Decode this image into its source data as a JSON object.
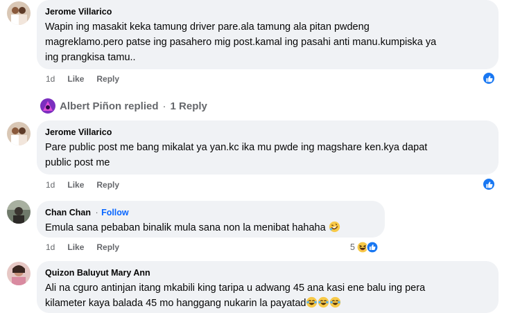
{
  "comments": [
    {
      "author": "Jerome Villarico",
      "text_lines": [
        "Wapin ing masakit keka tamung driver pare.ala tamung ala pitan pwdeng",
        "magreklamo.pero patse ing pasahero mig post.kamal ing pasahi anti manu.kumpiska ya",
        "ing prangkisa tamu.."
      ],
      "age": "1d",
      "like_label": "Like",
      "reply_label": "Reply",
      "reaction": "like"
    },
    {
      "author": "Jerome Villarico",
      "text_lines": [
        "Pare public post me bang mikalat ya yan.kc ika mu pwde ing magshare ken.kya dapat",
        "public post me"
      ],
      "age": "1d",
      "like_label": "Like",
      "reply_label": "Reply",
      "reaction": "like"
    },
    {
      "author": "Chan Chan",
      "separator": "·",
      "follow_label": "Follow",
      "text": "Emula sana pebaban binalik mula sana non la menibat hahaha",
      "emoji": "rofl",
      "age": "1d",
      "like_label": "Like",
      "reply_label": "Reply",
      "reaction_count": "5",
      "reactions": [
        "haha",
        "like"
      ]
    },
    {
      "author": "Quizon Baluyut Mary Ann",
      "text_lines": [
        "Ali na cguro antinjan itang mkabili king taripa u adwang 45 ana kasi ene balu ing pera",
        "kilameter kaya balada 45 mo hanggang nukarin la payatad"
      ],
      "trailing_emoji": [
        "joy",
        "joy",
        "joy"
      ]
    }
  ],
  "reply_summary": {
    "name": "Albert Piñon replied",
    "dot": "·",
    "count_label": "1 Reply"
  },
  "colors": {
    "bubble": "#f0f2f5",
    "muted_text": "#65676b",
    "link_blue": "#0866ff",
    "like_blue": "#1877f2"
  }
}
